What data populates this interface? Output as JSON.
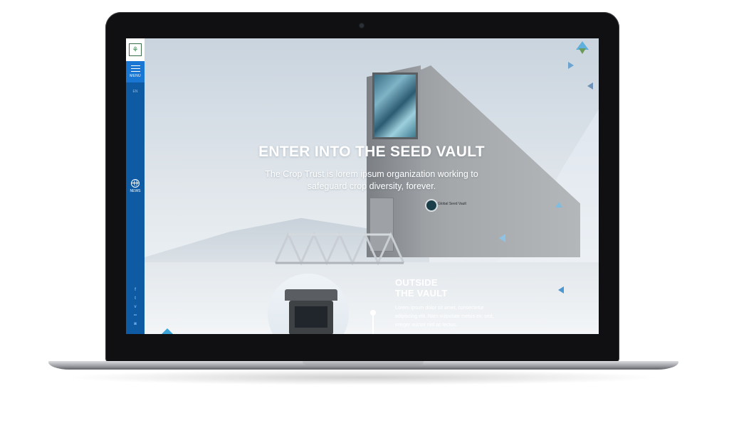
{
  "sidebar": {
    "logo_icon": "crop-trust-logo",
    "menu_label": "MENU",
    "language": "EN",
    "news_label": "NEWS",
    "social_icons": [
      "facebook-icon",
      "twitter-icon",
      "vimeo-icon",
      "flickr-icon",
      "instagram-icon"
    ]
  },
  "hero": {
    "title": "ENTER INTO THE SEED VAULT",
    "subtitle": "The Crop Trust is lorem ipsum organization working to safeguard crop diversity, forever."
  },
  "section": {
    "title_line1": "OUTSIDE",
    "title_line2": "THE VAULT",
    "body": "Lorem ipsum dolor sit amet, consectetur adipiscing elit. Nam vulputate metus ex, sed, integer auctor nisl ac lectus."
  },
  "building_sign": "Global Seed Vault",
  "colors": {
    "sidebar_blue": "#0e5ba4",
    "menu_blue": "#1976d2",
    "accent_triangle": "#3aa3d8"
  }
}
